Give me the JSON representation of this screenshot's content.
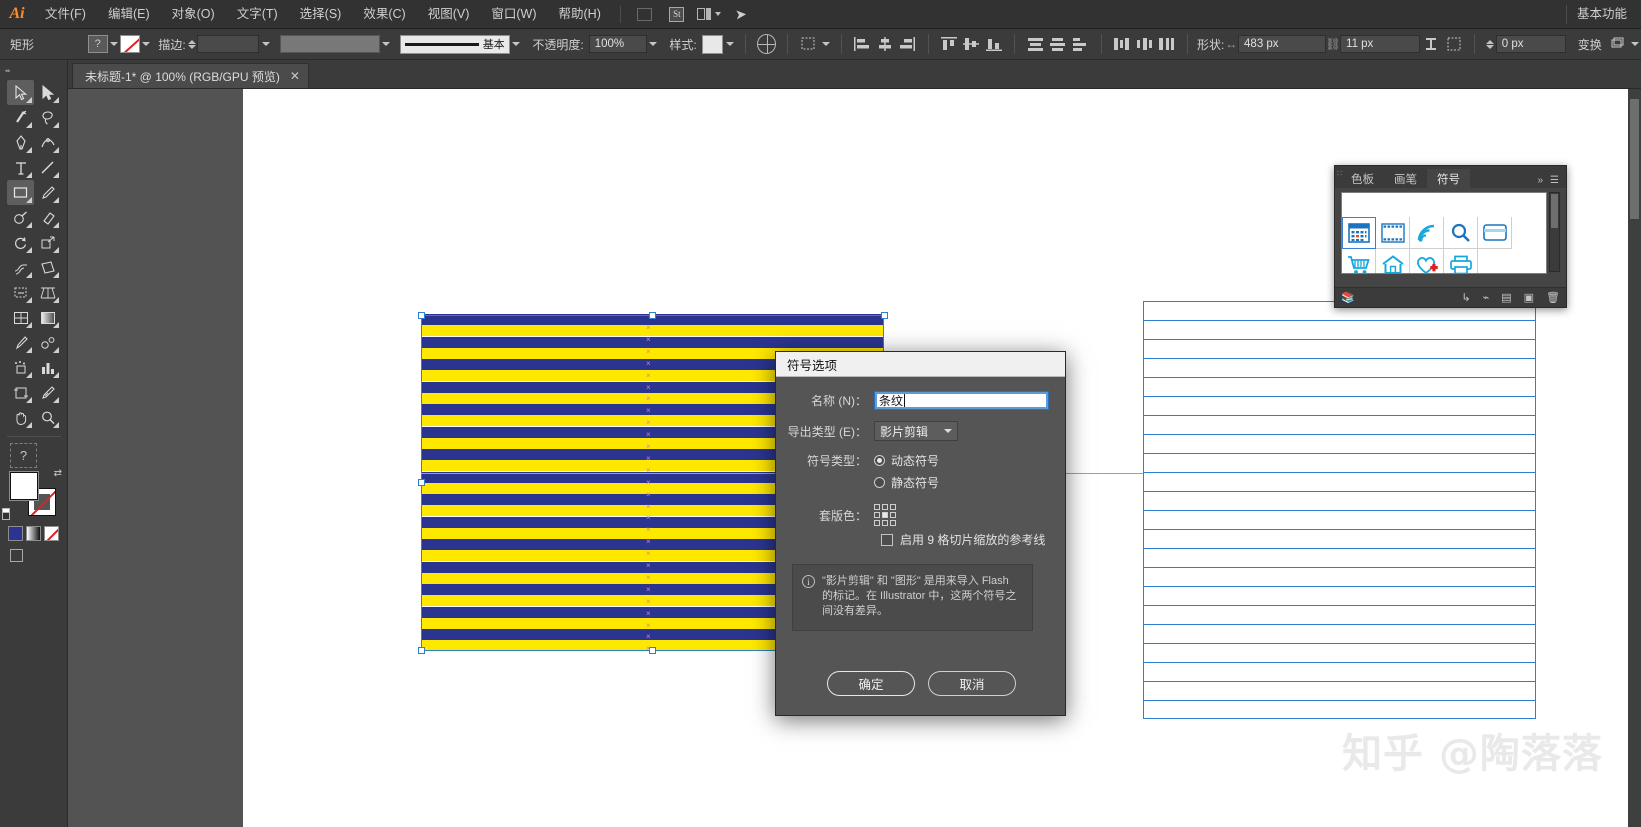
{
  "app": {
    "logo": "Ai",
    "workspace": "基本功能"
  },
  "menu": {
    "items": [
      "文件(F)",
      "编辑(E)",
      "对象(O)",
      "文字(T)",
      "选择(S)",
      "效果(C)",
      "视图(V)",
      "窗口(W)",
      "帮助(H)"
    ],
    "icons": [
      "bridge-icon",
      "stock-icon",
      "arrange-documents-icon",
      "chevron-down-icon",
      "share-icon"
    ],
    "stock_label": "St"
  },
  "control_bar": {
    "tool_name": "矩形",
    "fill_label": "?",
    "stroke_label": "描边:",
    "stroke_weight": "",
    "profile_label": "基本",
    "opacity_label": "不透明度:",
    "opacity_value": "100%",
    "style_label": "样式:",
    "shape_label": "形状:",
    "width_value": "483 px",
    "height_value": "11 px",
    "transform_label": "变换",
    "offset_value": "0 px",
    "icons": [
      "recolor-artwork-icon",
      "transform-each-icon",
      "align-left-icon",
      "align-center-h-icon",
      "align-right-icon",
      "align-top-icon",
      "align-middle-v-icon",
      "align-bottom-icon",
      "distribute-v-center-icon",
      "distribute-v-bottom-icon",
      "distribute-v-top-icon",
      "distribute-h-left-icon",
      "distribute-h-center-icon",
      "distribute-h-right-icon",
      "link-dimensions-icon",
      "isolate-icon",
      "arrange-icon"
    ]
  },
  "tab": {
    "title": "未标题-1* @ 100% (RGB/GPU 预览)",
    "close": "✕"
  },
  "toolbar": {
    "tools": [
      "selection-tool",
      "direct-selection-tool",
      "magic-wand-tool",
      "lasso-tool",
      "pen-tool",
      "curvature-tool",
      "type-tool",
      "line-segment-tool",
      "rectangle-tool",
      "paintbrush-tool",
      "shaper-tool",
      "eraser-tool",
      "rotate-tool",
      "scale-tool",
      "width-tool",
      "free-transform-tool",
      "shape-builder-tool",
      "perspective-grid-tool",
      "mesh-tool",
      "gradient-tool",
      "eyedropper-tool",
      "blend-tool",
      "symbol-sprayer-tool",
      "column-graph-tool",
      "artboard-tool",
      "slice-tool",
      "hand-tool",
      "zoom-tool"
    ],
    "help_label": "?",
    "fill_stroke": "fill-stroke-swatches",
    "colors": [
      "#2b3590",
      "gradient",
      "none"
    ]
  },
  "symbols_panel": {
    "tabs": [
      "色板",
      "画笔",
      "符号"
    ],
    "active_tab": "符号",
    "symbols": [
      "calendar-symbol",
      "film-strip-symbol",
      "wifi-symbol",
      "search-symbol",
      "card-symbol",
      "shopping-cart-symbol",
      "home-symbol",
      "heart-plus-symbol",
      "printer-symbol"
    ],
    "footer_icons": [
      "symbol-libraries-icon",
      "place-symbol-instance-icon",
      "break-link-icon",
      "symbol-options-icon",
      "new-symbol-icon",
      "delete-symbol-icon"
    ],
    "collapse_icon": "double-chevron-right-icon",
    "menu_icon": "panel-menu-icon"
  },
  "dialog": {
    "title": "符号选项",
    "name_label": "名称 (N)：",
    "name_value": "条纹",
    "export_label": "导出类型 (E)：",
    "export_value": "影片剪辑",
    "symbol_type_label": "符号类型：",
    "symbol_type_options": [
      "动态符号",
      "静态符号"
    ],
    "symbol_type_selected": "动态符号",
    "registration_label": "套版色：",
    "registration_value": "center",
    "checkbox_label": "启用 9 格切片缩放的参考线",
    "checkbox_checked": false,
    "info_icon": "info-icon",
    "info_text": "\"影片剪辑\" 和 \"图形\" 是用来导入 Flash 的标记。在 Illustrator 中，这两个符号之间没有差异。",
    "ok_label": "确定",
    "cancel_label": "取消"
  },
  "canvas": {
    "artwork_name": "striped-rectangle-artwork",
    "stripe_colors": {
      "blue": "#2b3590",
      "yellow": "#ffe800"
    },
    "stripe_count": 30,
    "selection_color": "#2f7fd1",
    "guide_color": "#cf7fcf",
    "watermark": "知乎 @陶落落",
    "line_rows": 22
  }
}
